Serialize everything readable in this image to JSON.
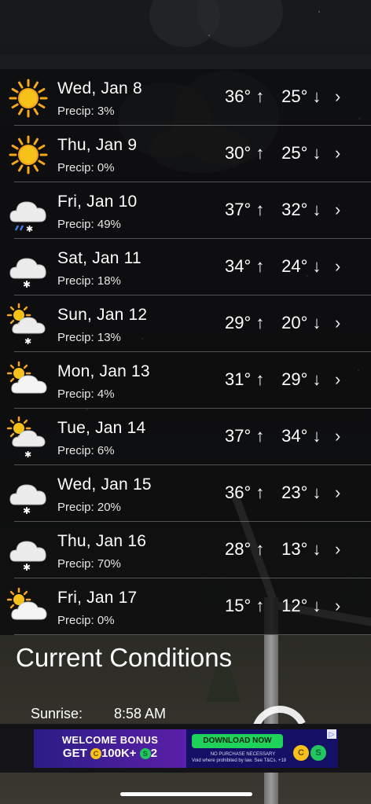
{
  "forecast": [
    {
      "day": "Wed, Jan 8",
      "precip": "Precip: 3%",
      "hi": "36°",
      "lo": "25°",
      "icon": "sun-icon"
    },
    {
      "day": "Thu, Jan 9",
      "precip": "Precip: 0%",
      "hi": "30°",
      "lo": "25°",
      "icon": "sun-icon"
    },
    {
      "day": "Fri, Jan 10",
      "precip": "Precip: 49%",
      "hi": "37°",
      "lo": "32°",
      "icon": "cloud-mixed-precip-icon"
    },
    {
      "day": "Sat, Jan 11",
      "precip": "Precip: 18%",
      "hi": "34°",
      "lo": "24°",
      "icon": "cloud-snow-icon"
    },
    {
      "day": "Sun, Jan 12",
      "precip": "Precip: 13%",
      "hi": "29°",
      "lo": "20°",
      "icon": "partly-cloudy-snow-icon"
    },
    {
      "day": "Mon, Jan 13",
      "precip": "Precip: 4%",
      "hi": "31°",
      "lo": "29°",
      "icon": "partly-cloudy-icon"
    },
    {
      "day": "Tue, Jan 14",
      "precip": "Precip: 6%",
      "hi": "37°",
      "lo": "34°",
      "icon": "partly-cloudy-snow-icon"
    },
    {
      "day": "Wed, Jan 15",
      "precip": "Precip: 20%",
      "hi": "36°",
      "lo": "23°",
      "icon": "cloud-snow-icon"
    },
    {
      "day": "Thu, Jan 16",
      "precip": "Precip: 70%",
      "hi": "28°",
      "lo": "13°",
      "icon": "cloud-snow-icon"
    },
    {
      "day": "Fri, Jan 17",
      "precip": "Precip: 0%",
      "hi": "15°",
      "lo": "12°",
      "icon": "partly-cloudy-icon"
    }
  ],
  "arrows": {
    "up": "↑",
    "down": "↓",
    "chevron": "›"
  },
  "current": {
    "title": "Current Conditions",
    "sunrise_label": "Sunrise:",
    "sunrise_value": "8:58 AM"
  },
  "ad": {
    "line1": "WELCOME BONUS",
    "line2": "GET",
    "amount": "100K+",
    "amount2": "2",
    "download": "DOWNLOAD NOW",
    "fine1": "NO PURCHASE NECESSARY",
    "fine2": "Void where prohibited by law. See T&Cs. +18",
    "coin_c": "C",
    "coin_s": "S",
    "close": "▷"
  },
  "colors": {
    "sun": "#f6c21a",
    "cloud": "#e9e9e9",
    "rain": "#3f7de0",
    "list_bg": "#0c0c0e"
  }
}
